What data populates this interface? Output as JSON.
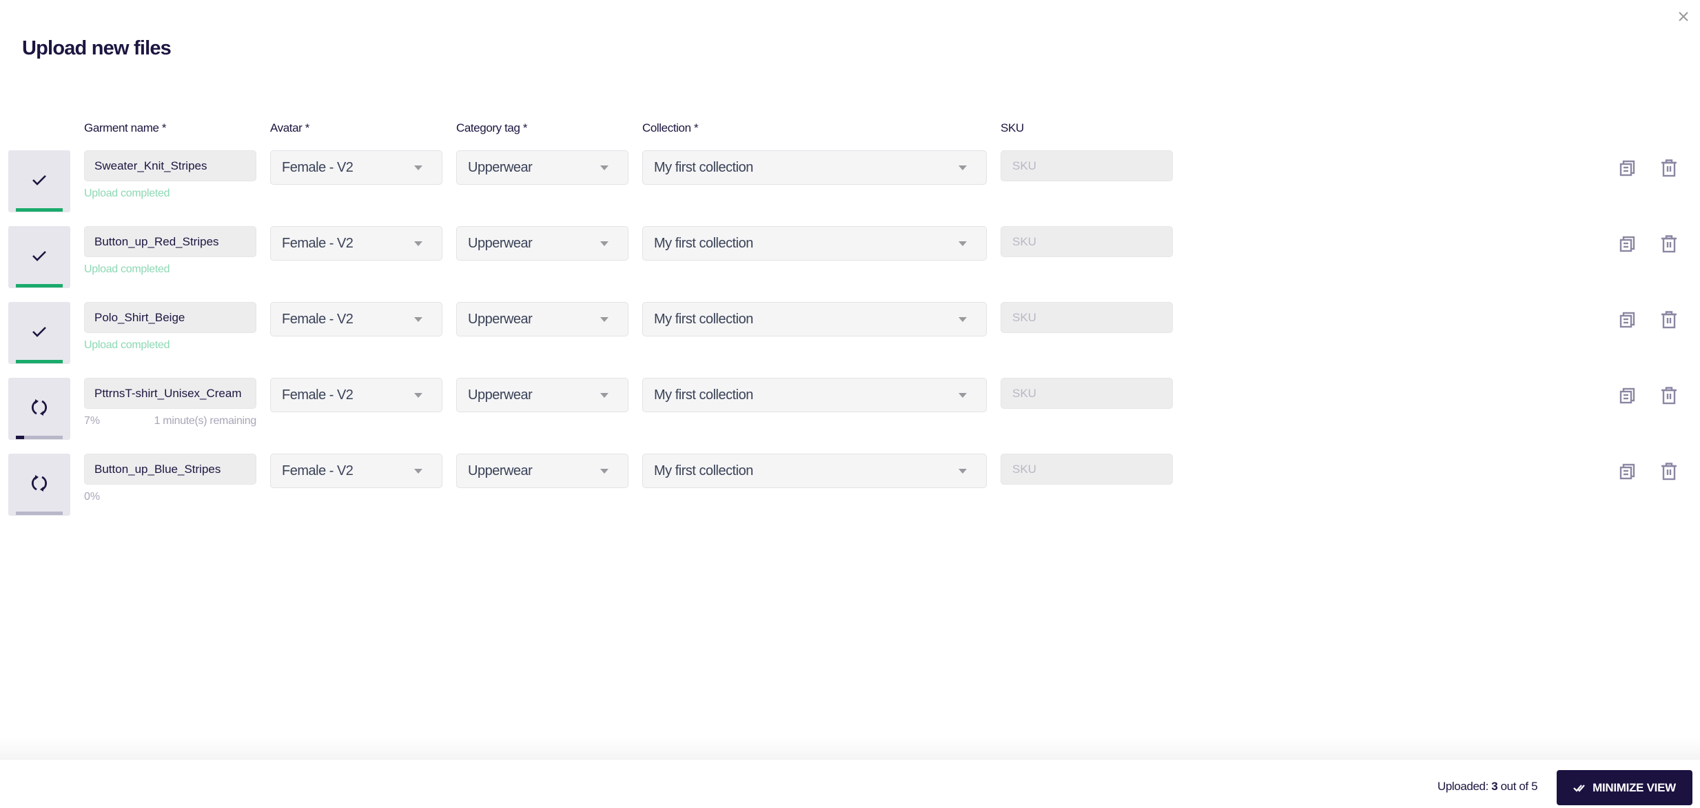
{
  "dialog": {
    "title": "Upload new files",
    "close_icon": "close-icon"
  },
  "columns": {
    "garment_name": "Garment name *",
    "avatar": "Avatar *",
    "category_tag": "Category tag *",
    "collection": "Collection *",
    "sku": "SKU"
  },
  "rows": [
    {
      "garment_name": "Sweater_Knit_Stripes",
      "state": "completed",
      "status_text": "Upload completed",
      "progress": 1.0,
      "avatar": "Female - V2",
      "category_tag": "Upperwear",
      "collection": "My first collection",
      "sku": "",
      "sku_placeholder": "SKU"
    },
    {
      "garment_name": "Button_up_Red_Stripes",
      "state": "completed",
      "status_text": "Upload completed",
      "progress": 1.0,
      "avatar": "Female - V2",
      "category_tag": "Upperwear",
      "collection": "My first collection",
      "sku": "",
      "sku_placeholder": "SKU"
    },
    {
      "garment_name": "Polo_Shirt_Beige",
      "state": "completed",
      "status_text": "Upload completed",
      "progress": 1.0,
      "avatar": "Female - V2",
      "category_tag": "Upperwear",
      "collection": "My first collection",
      "sku": "",
      "sku_placeholder": "SKU"
    },
    {
      "garment_name": "PttrnsT-shirt_Unisex_Cream",
      "state": "uploading",
      "percent_text": "7%",
      "remaining_text": "1 minute(s) remaining",
      "progress": 0.07,
      "avatar": "Female - V2",
      "category_tag": "Upperwear",
      "collection": "My first collection",
      "sku": "",
      "sku_placeholder": "SKU"
    },
    {
      "garment_name": "Button_up_Blue_Stripes",
      "state": "queued",
      "percent_text": "0%",
      "remaining_text": "",
      "progress": 0.0,
      "avatar": "Female - V2",
      "category_tag": "Upperwear",
      "collection": "My first collection",
      "sku": "",
      "sku_placeholder": "SKU"
    }
  ],
  "footer": {
    "uploaded_label": "Uploaded:",
    "uploaded_count": "3",
    "total_label": "out of 5",
    "minimize_label": "MINIMIZE VIEW"
  },
  "colors": {
    "brand_dark": "#1b1240",
    "success_green": "#1aab6b",
    "success_text": "#8dd8b4",
    "icon_gray": "#8a87a3"
  }
}
